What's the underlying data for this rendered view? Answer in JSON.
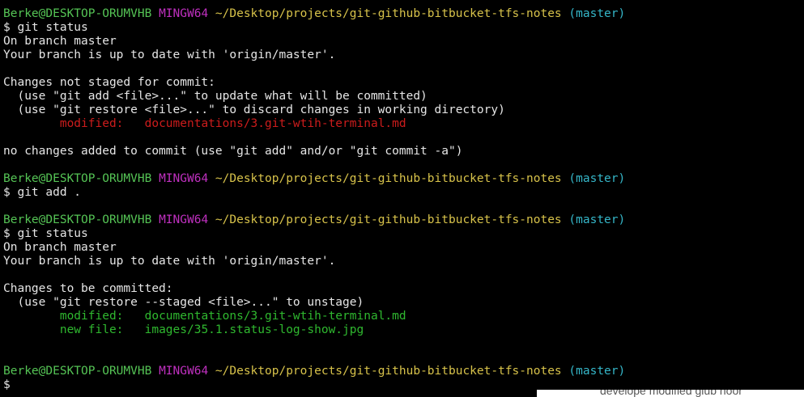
{
  "terminal": {
    "prompt": {
      "user_host": "Berke@DESKTOP-ORUMVHB",
      "system": "MINGW64",
      "path": "~/Desktop/projects/git-github-bitbucket-tfs-notes",
      "branch": "(master)"
    },
    "blocks": {
      "cmd1": "$ git status",
      "l_on_branch_1": "On branch master",
      "l_up_to_date_1": "Your branch is up to date with 'origin/master'.",
      "l_not_staged": "Changes not staged for commit:",
      "l_hint_add": "  (use \"git add <file>...\" to update what will be committed)",
      "l_hint_restore": "  (use \"git restore <file>...\" to discard changes in working directory)",
      "l_modified_label_1": "        modified:   ",
      "l_modified_file_1": "documentations/3.git-wtih-terminal.md",
      "l_no_changes": "no changes added to commit (use \"git add\" and/or \"git commit -a\")",
      "cmd2": "$ git add .",
      "cmd3": "$ git status",
      "l_on_branch_2": "On branch master",
      "l_up_to_date_2": "Your branch is up to date with 'origin/master'.",
      "l_to_be_committed": "Changes to be committed:",
      "l_hint_unstage": "  (use \"git restore --staged <file>...\" to unstage)",
      "l_modified_label_2": "        modified:   ",
      "l_modified_file_2": "documentations/3.git-wtih-terminal.md",
      "l_newfile_label": "        new file:   ",
      "l_newfile_file": "images/35.1.status-log-show.jpg",
      "cursor_prompt": "$"
    },
    "edge_text": "develope modified  glub noor"
  },
  "colors": {
    "background": "#000000",
    "user_host": "#55c455",
    "system": "#c030c0",
    "path": "#d7c24a",
    "branch": "#35b6c8",
    "unstaged": "#cc1c1c",
    "staged": "#2fb82f"
  }
}
